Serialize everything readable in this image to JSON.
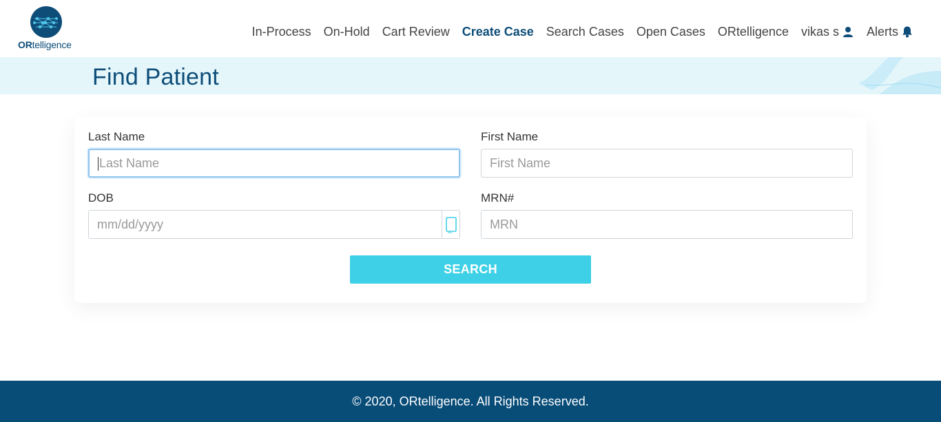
{
  "brand": {
    "name_bold": "OR",
    "name_rest": "telligence",
    "color": "#0d4d78"
  },
  "nav": {
    "items": [
      {
        "label": "In-Process"
      },
      {
        "label": "On-Hold"
      },
      {
        "label": "Cart Review"
      },
      {
        "label": "Create Case",
        "active": true
      },
      {
        "label": "Search Cases"
      },
      {
        "label": "Open Cases"
      },
      {
        "label": "ORtelligence"
      }
    ],
    "user_label": "vikas s",
    "user_icon": "user-icon",
    "alerts_label": "Alerts",
    "alerts_icon": "bell-icon"
  },
  "page": {
    "title": "Find Patient"
  },
  "form": {
    "last_name": {
      "label": "Last Name",
      "placeholder": "Last Name",
      "value": ""
    },
    "first_name": {
      "label": "First Name",
      "placeholder": "First Name",
      "value": ""
    },
    "dob": {
      "label": "DOB",
      "placeholder": "mm/dd/yyyy",
      "value": "",
      "icon": "calendar-icon"
    },
    "mrn": {
      "label": "MRN#",
      "placeholder": "MRN",
      "value": ""
    },
    "search_label": "SEARCH"
  },
  "footer": {
    "text": "© 2020, ORtelligence. All Rights Reserved."
  },
  "colors": {
    "primary": "#0d4d78",
    "accent": "#3ed0e6",
    "band": "#e5f6fb",
    "footer": "#084c78"
  }
}
